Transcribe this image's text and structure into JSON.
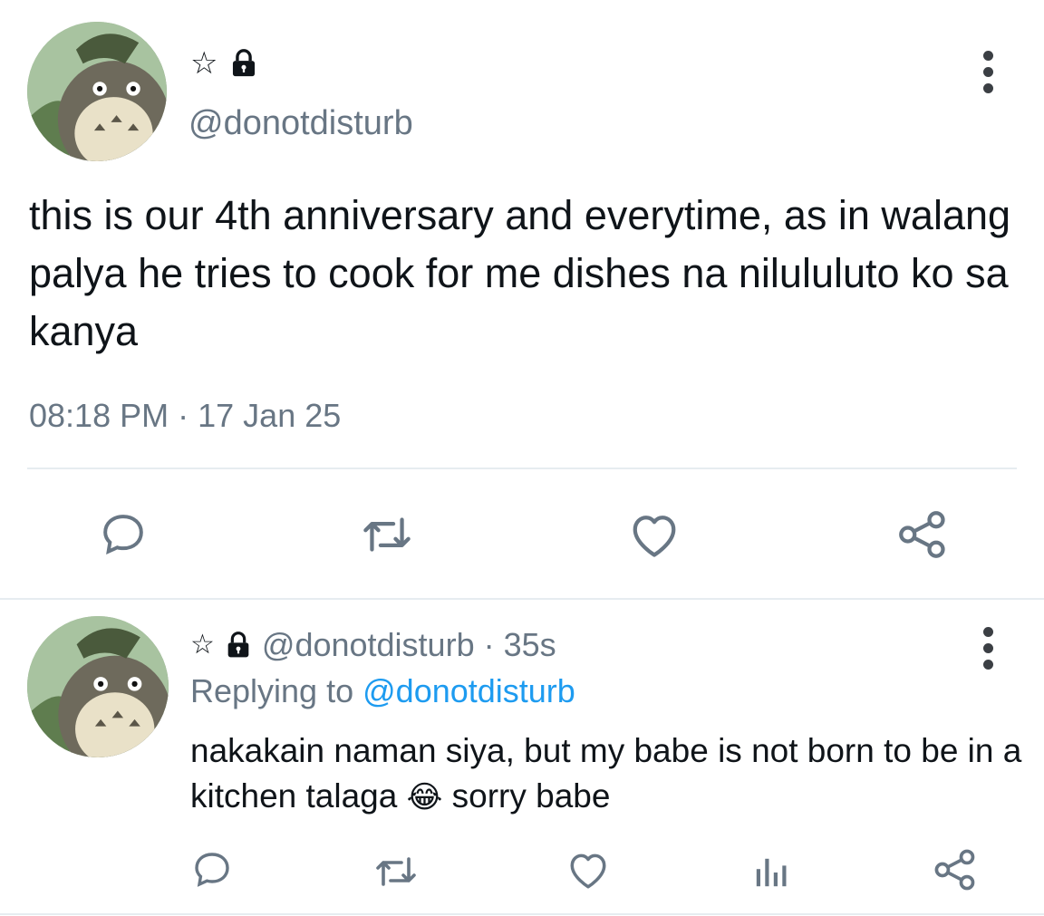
{
  "main_tweet": {
    "name_star": "☆",
    "handle": "@donotdisturb",
    "text": "this is our 4th anniversary and everytime, as in walang palya he tries to cook for me dishes na nilululuto ko sa kanya",
    "time": "08:18 PM",
    "separator": "·",
    "date": "17 Jan 25",
    "actions": [
      "reply-icon",
      "retweet-icon",
      "like-icon",
      "share-icon"
    ]
  },
  "reply_tweet": {
    "name_star": "☆",
    "handle": "@donotdisturb",
    "dot": "·",
    "age": "35s",
    "replying_prefix": "Replying to",
    "replying_handle": "@donotdisturb",
    "text_part1": "nakakain naman siya, but my babe is not born to be in a kitchen talaga",
    "emoji": "😂",
    "text_part2": "sorry babe",
    "actions": [
      "reply-icon",
      "retweet-icon",
      "like-icon",
      "analytics-icon",
      "share-icon"
    ]
  },
  "colors": {
    "text": "#0f1419",
    "muted": "#687684",
    "link": "#1d9bf0",
    "divider": "#e6ecf0"
  }
}
